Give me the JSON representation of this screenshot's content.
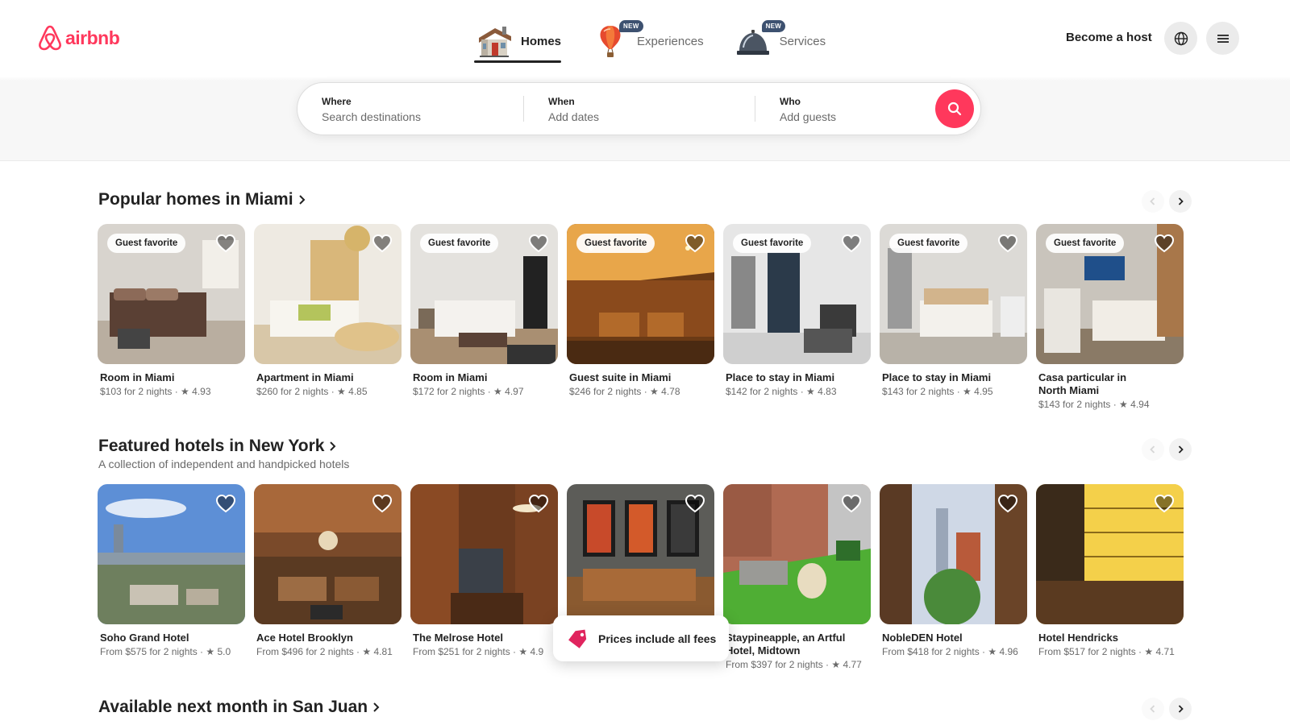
{
  "brand": {
    "name": "airbnb",
    "color": "#ff385c"
  },
  "nav": {
    "tabs": [
      {
        "label": "Homes",
        "icon": "house-icon",
        "active": true,
        "badge": ""
      },
      {
        "label": "Experiences",
        "icon": "hot-air-balloon-icon",
        "active": false,
        "badge": "NEW"
      },
      {
        "label": "Services",
        "icon": "service-bell-icon",
        "active": false,
        "badge": "NEW"
      }
    ]
  },
  "header": {
    "host_label": "Become a host",
    "globe_icon": "globe-icon",
    "menu_icon": "hamburger-menu-icon"
  },
  "search": {
    "where_label": "Where",
    "where_placeholder": "Search destinations",
    "when_label": "When",
    "when_placeholder": "Add dates",
    "who_label": "Who",
    "who_placeholder": "Add guests",
    "button_icon": "search-icon"
  },
  "sections": [
    {
      "title": "Popular homes in Miami",
      "subtitle": "",
      "listings": [
        {
          "title": "Room in Miami",
          "meta": "$103 for 2 nights · ★ 4.93",
          "badge": "Guest favorite"
        },
        {
          "title": "Apartment in Miami",
          "meta": "$260 for 2 nights · ★ 4.85",
          "badge": ""
        },
        {
          "title": "Room in Miami",
          "meta": "$172 for 2 nights · ★ 4.97",
          "badge": "Guest favorite"
        },
        {
          "title": "Guest suite in Miami",
          "meta": "$246 for 2 nights · ★ 4.78",
          "badge": "Guest favorite"
        },
        {
          "title": "Place to stay in Miami",
          "meta": "$142 for 2 nights · ★ 4.83",
          "badge": "Guest favorite"
        },
        {
          "title": "Place to stay in Miami",
          "meta": "$143 for 2 nights · ★ 4.95",
          "badge": "Guest favorite"
        },
        {
          "title": "Casa particular in North Miami",
          "meta": "$143 for 2 nights · ★ 4.94",
          "badge": "Guest favorite"
        }
      ]
    },
    {
      "title": "Featured hotels in New York",
      "subtitle": "A collection of independent and handpicked hotels",
      "listings": [
        {
          "title": "Soho Grand Hotel",
          "meta": "From $575 for 2 nights · ★ 5.0",
          "badge": ""
        },
        {
          "title": "Ace Hotel Brooklyn",
          "meta": "From $496 for 2 nights · ★ 4.81",
          "badge": ""
        },
        {
          "title": "The Melrose Hotel",
          "meta": "From $251 for 2 nights · ★ 4.9",
          "badge": ""
        },
        {
          "title": "",
          "meta": "",
          "badge": ""
        },
        {
          "title": "Staypineapple, an Artful Hotel, Midtown",
          "meta": "From $397 for 2 nights · ★ 4.77",
          "badge": ""
        },
        {
          "title": "NobleDEN Hotel",
          "meta": "From $418 for 2 nights · ★ 4.96",
          "badge": ""
        },
        {
          "title": "Hotel Hendricks",
          "meta": "From $517 for 2 nights · ★ 4.71",
          "badge": ""
        }
      ]
    },
    {
      "title": "Available next month in San Juan",
      "subtitle": "",
      "listings": []
    }
  ],
  "fees_pill": {
    "label": "Prices include all fees",
    "icon": "price-tag-icon"
  }
}
